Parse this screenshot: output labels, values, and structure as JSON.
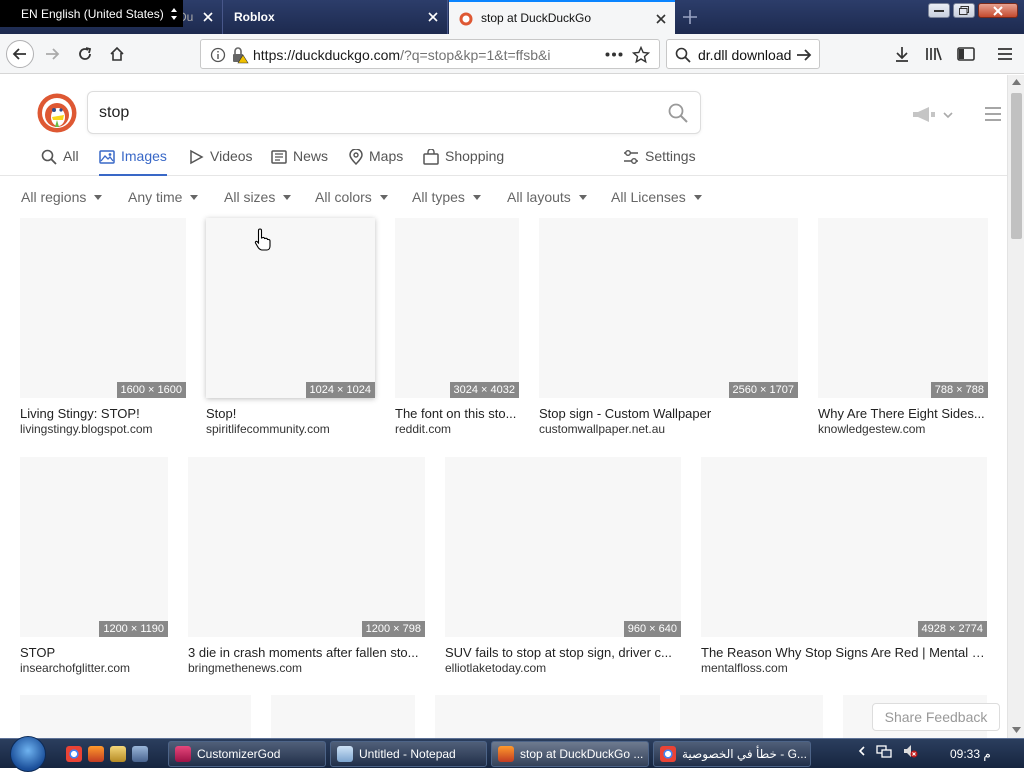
{
  "browser": {
    "language_overlay": "EN English (United States)",
    "tabs": [
      {
        "title": "Du"
      },
      {
        "title": "Roblox"
      },
      {
        "title": "stop at DuckDuckGo"
      }
    ],
    "url": {
      "host": "https://duckduckgo.com",
      "path": "/?q=stop&kp=1&t=ffsb&i"
    },
    "search_box_value": "dr.dll download"
  },
  "ddg": {
    "query": "stop",
    "verticals": [
      "All",
      "Images",
      "Videos",
      "News",
      "Maps",
      "Shopping"
    ],
    "active_vertical": "Images",
    "settings_label": "Settings",
    "filters": [
      "All regions",
      "Any time",
      "All sizes",
      "All colors",
      "All types",
      "All layouts",
      "All Licenses"
    ],
    "results_row1": [
      {
        "dims": "1600 × 1600",
        "title": "Living Stingy: STOP!",
        "source": "livingstingy.blogspot.com"
      },
      {
        "dims": "1024 × 1024",
        "title": "Stop!",
        "source": "spiritlifecommunity.com"
      },
      {
        "dims": "3024 × 4032",
        "title": "The font on this sto...",
        "source": "reddit.com"
      },
      {
        "dims": "2560 × 1707",
        "title": "Stop sign - Custom Wallpaper",
        "source": "customwallpaper.net.au"
      },
      {
        "dims": "788 × 788",
        "title": "Why Are There Eight Sides...",
        "source": "knowledgestew.com"
      }
    ],
    "results_row2": [
      {
        "dims": "1200 × 1190",
        "title": "STOP",
        "source": "insearchofglitter.com"
      },
      {
        "dims": "1200 × 798",
        "title": "3 die in crash moments after fallen sto...",
        "source": "bringmethenews.com"
      },
      {
        "dims": "960 × 640",
        "title": "SUV fails to stop at stop sign, driver c...",
        "source": "elliotlaketoday.com"
      },
      {
        "dims": "4928 × 2774",
        "title": "The Reason Why Stop Signs Are Red | Mental F...",
        "source": "mentalfloss.com"
      }
    ],
    "feedback_label": "Share Feedback"
  },
  "taskbar": {
    "buttons": [
      "CustomizerGod",
      "Untitled - Notepad",
      "stop at DuckDuckGo ...",
      "خطأ في الخصوصية - G..."
    ],
    "clock": "09:33 م"
  },
  "colors": {
    "accent": "#3968c7",
    "tab_accent": "#0a84ff",
    "ddg_orange": "#de5833"
  }
}
